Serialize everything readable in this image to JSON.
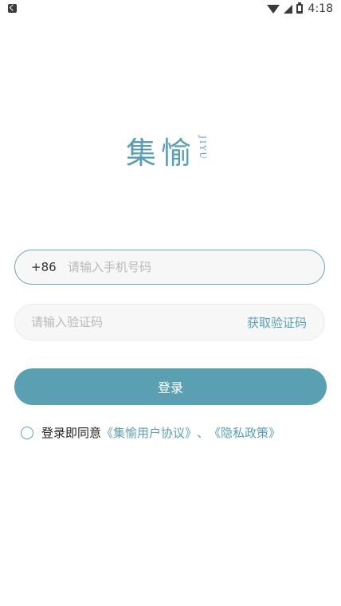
{
  "status_bar": {
    "time": "4:18"
  },
  "logo": {
    "title": "集愉",
    "subtitle": "JIYU"
  },
  "phone": {
    "prefix": "+86",
    "placeholder": "请输入手机号码",
    "value": ""
  },
  "code": {
    "placeholder": "请输入验证码",
    "value": "",
    "get_code_label": "获取验证码"
  },
  "login_button": {
    "label": "登录"
  },
  "agreement": {
    "text": "登录即同意",
    "user_agreement": "《集愉用户协议》",
    "separator": "、",
    "privacy_policy": "《隐私政策》",
    "checked": false
  },
  "colors": {
    "accent": "#5b9fb3",
    "field_bg": "#f7f7f7",
    "placeholder": "#b8b8b8"
  },
  "icons": [
    "wifi-icon",
    "signal-icon",
    "battery-icon",
    "notification-icon"
  ]
}
